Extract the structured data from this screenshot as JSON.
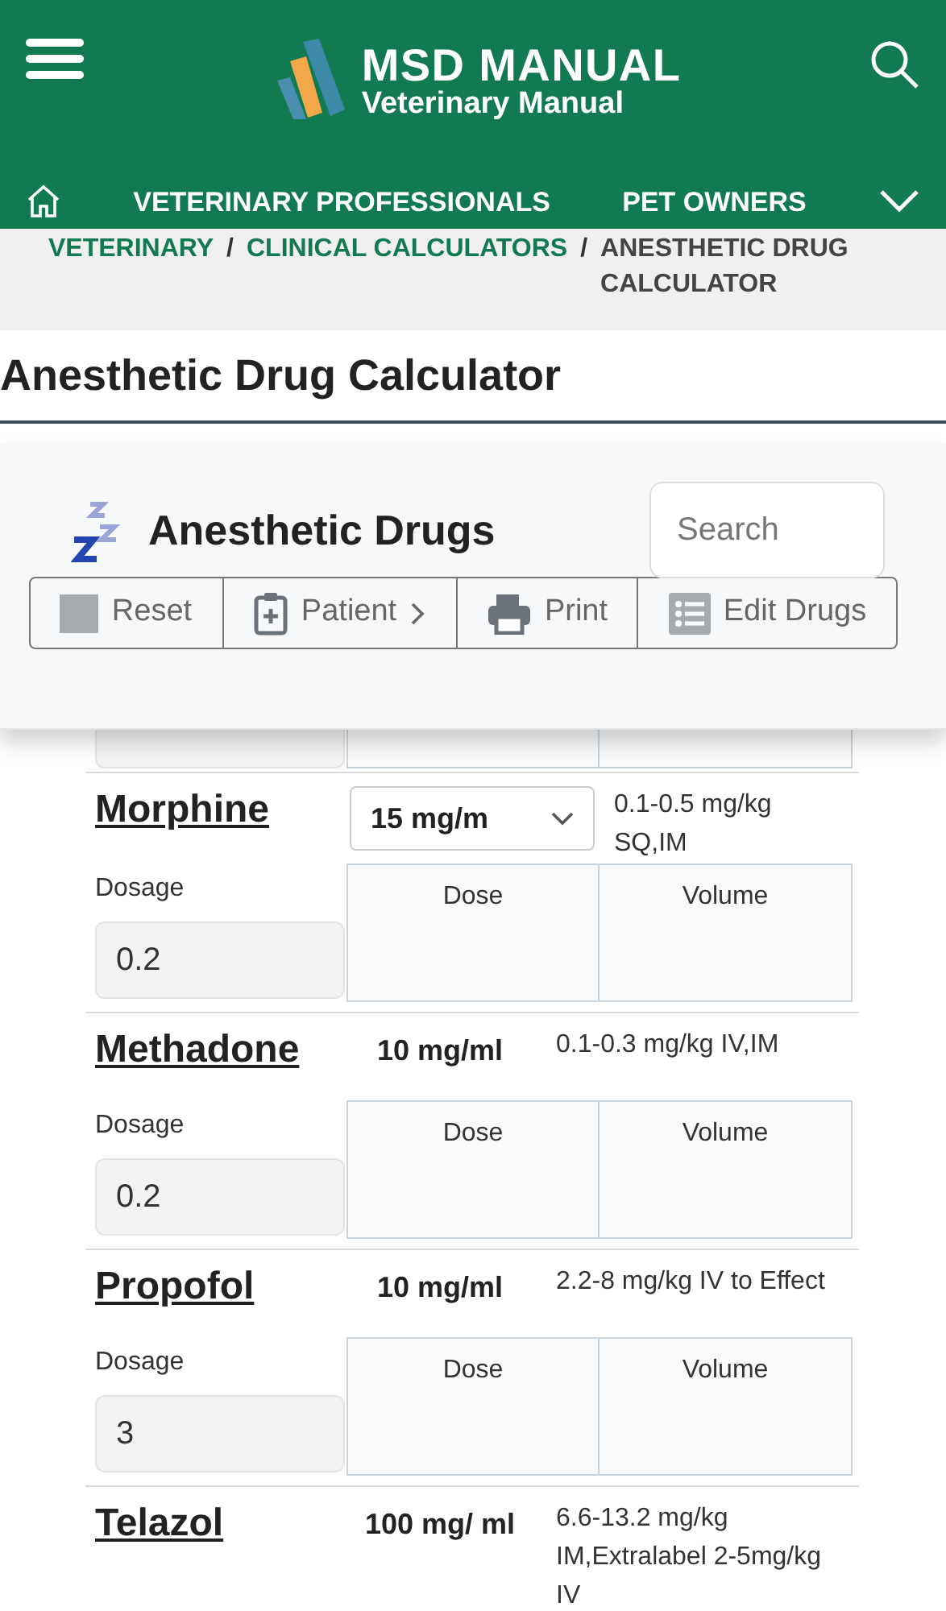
{
  "header": {
    "brand": "MSD MANUAL",
    "subtitle": "Veterinary Manual"
  },
  "nav": [
    "VETERINARY PROFESSIONALS",
    "PET OWNERS"
  ],
  "breadcrumb": [
    {
      "text": "VETERINARY",
      "kind": "link"
    },
    {
      "text": "/",
      "kind": "separator"
    },
    {
      "text": "CLINICAL CALCULATORS",
      "kind": "link"
    },
    {
      "text": "/",
      "kind": "separator"
    },
    {
      "text": "ANESTHETIC DRUG CALCULATOR",
      "kind": "current"
    }
  ],
  "page_title": "Anesthetic Drug Calculator",
  "panel": {
    "title": "Anesthetic Drugs",
    "search": {
      "placeholder": "Search"
    },
    "toolbar": [
      {
        "label": "Reset",
        "kind": "reset"
      },
      {
        "label": "Patient",
        "kind": "patient"
      },
      {
        "label": "Print",
        "kind": "print"
      },
      {
        "label": "Edit Drugs",
        "kind": "edit"
      }
    ]
  },
  "drugs": [
    {
      "name": "Morphine",
      "concentration": "15 mg/m",
      "kind": "select",
      "range": "0.1-0.5 mg/kg SQ,IM",
      "dosage_label": "Dosage",
      "dosage": "0.2",
      "dose_label": "Dose",
      "volume_label": "Volume"
    },
    {
      "name": "Methadone",
      "concentration": "10 mg/ml",
      "kind": "text",
      "range": "0.1-0.3 mg/kg IV,IM",
      "dosage_label": "Dosage",
      "dosage": "0.2",
      "dose_label": "Dose",
      "volume_label": "Volume"
    },
    {
      "name": "Propofol",
      "concentration": "10 mg/ml",
      "kind": "text",
      "range": "2.2-8 mg/kg IV to Effect",
      "dosage_label": "Dosage",
      "dosage": "3",
      "dose_label": "Dose",
      "volume_label": "Volume"
    },
    {
      "name": "Telazol",
      "concentration": "100 mg/ ml",
      "kind": "text",
      "range": "6.6-13.2 mg/kg IM,Extralabel 2-5mg/kg IV"
    }
  ]
}
